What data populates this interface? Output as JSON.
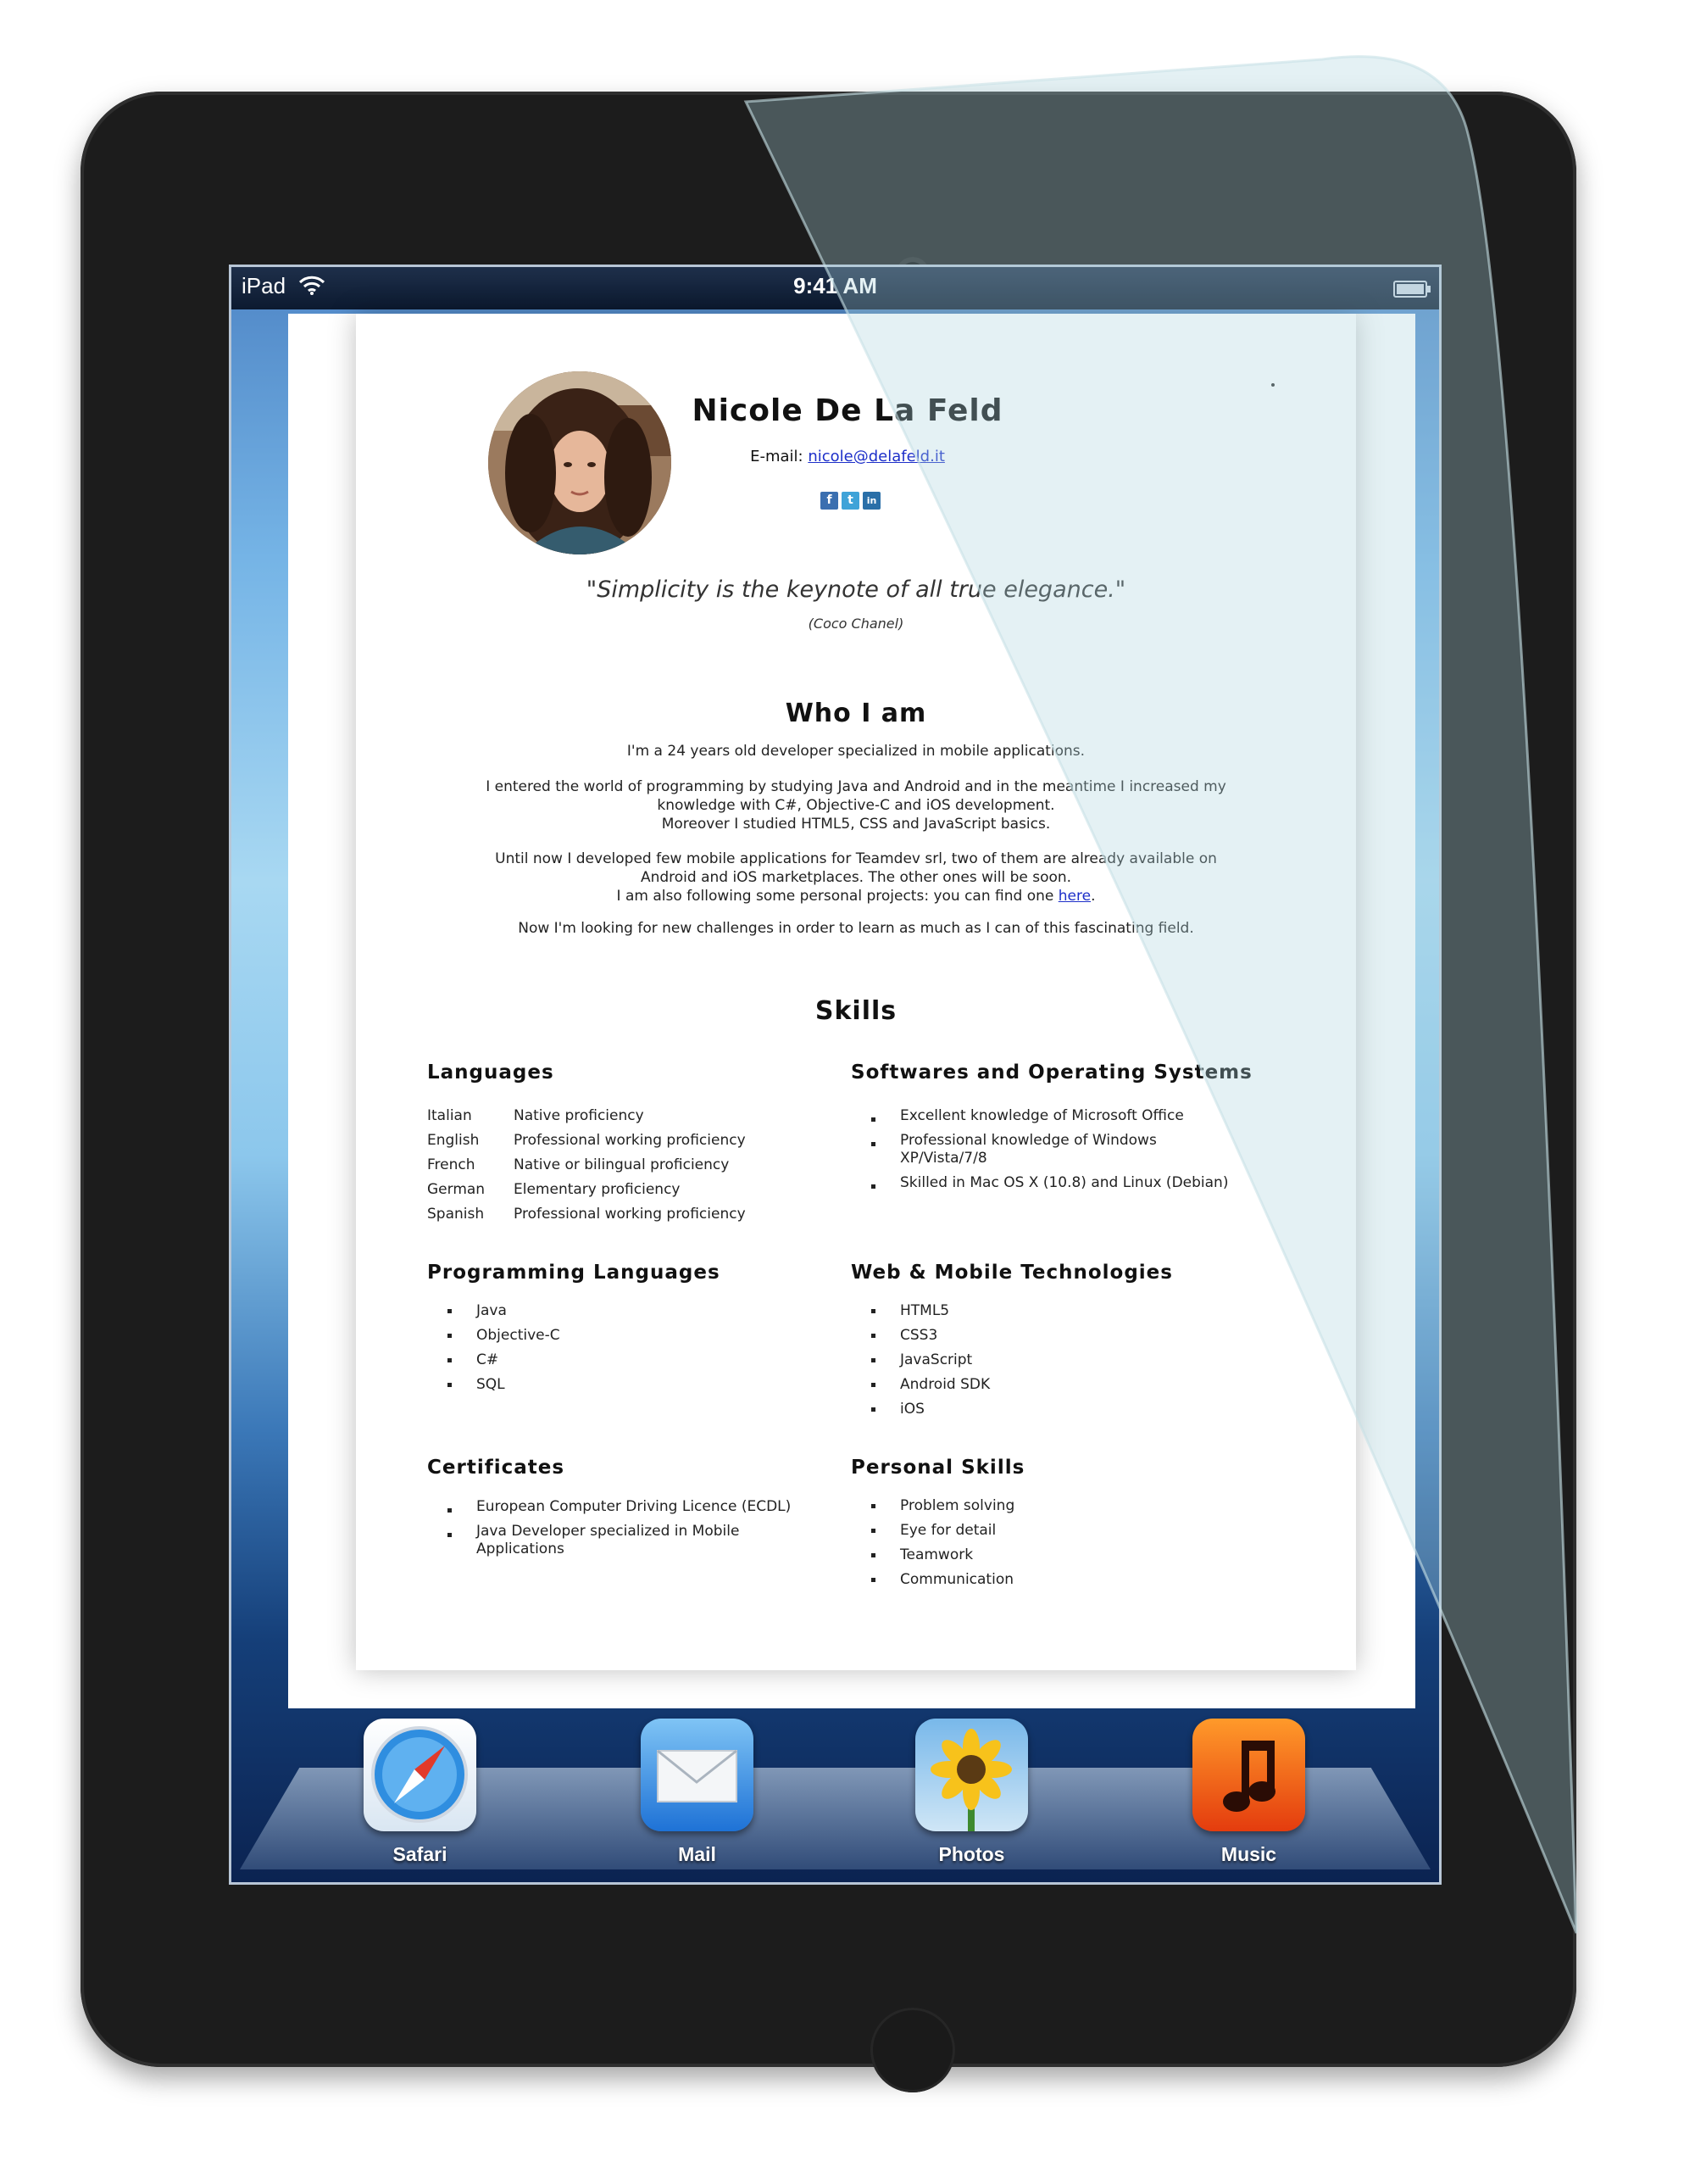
{
  "status_bar": {
    "carrier": "iPad",
    "time": "9:41 AM"
  },
  "profile": {
    "name": "Nicole De La Feld",
    "email_label": "E-mail:",
    "email": "nicole@delafeld.it",
    "social": [
      "f",
      "t",
      "in"
    ]
  },
  "quote": {
    "text": "\"Simplicity is the keynote of all true elegance.\"",
    "author": "(Coco Chanel)"
  },
  "who_i_am": {
    "title": "Who I am",
    "p1": "I'm a 24 years old developer specialized in mobile applications.",
    "p2a": "I entered the world of programming by studying Java and Android and in the meantime I increased my",
    "p2b": "knowledge with C#, Objective-C and iOS development.",
    "p2c": "Moreover I studied HTML5, CSS and JavaScript basics.",
    "p3a": "Until now I developed few mobile applications for Teamdev srl, two of them are already available on",
    "p3b": "Android and iOS marketplaces. The other ones will be soon.",
    "p3c": "I am also following some personal projects: you can find one",
    "p3_link": "here",
    "p4": "Now I'm looking for new challenges in order to learn as much as I can of this fascinating field."
  },
  "skills": {
    "title": "Skills",
    "languages": {
      "title": "Languages",
      "rows": [
        {
          "lang": "Italian",
          "level": "Native proficiency"
        },
        {
          "lang": "English",
          "level": "Professional working proficiency"
        },
        {
          "lang": "French",
          "level": "Native or bilingual proficiency"
        },
        {
          "lang": "German",
          "level": "Elementary proficiency"
        },
        {
          "lang": "Spanish",
          "level": "Professional working proficiency"
        }
      ]
    },
    "software": {
      "title": "Softwares and Operating Systems",
      "items": [
        "Excellent knowledge of Microsoft Office",
        "Professional knowledge of Windows XP/Vista/7/8",
        "Skilled in Mac OS X (10.8) and Linux (Debian)"
      ]
    },
    "programming": {
      "title": "Programming Languages",
      "items": [
        "Java",
        "Objective-C",
        "C#",
        "SQL"
      ]
    },
    "web_mobile": {
      "title": "Web & Mobile Technologies",
      "items": [
        "HTML5",
        "CSS3",
        "JavaScript",
        "Android SDK",
        "iOS"
      ]
    },
    "certificates": {
      "title": "Certificates",
      "items": [
        "European Computer Driving Licence (ECDL)",
        "Java Developer specialized in Mobile Applications"
      ]
    },
    "personal": {
      "title": "Personal Skills",
      "items": [
        "Problem solving",
        "Eye for detail",
        "Teamwork",
        "Communication"
      ]
    }
  },
  "dock": {
    "apps": [
      {
        "label": "Safari",
        "icon": "safari-compass-icon"
      },
      {
        "label": "Mail",
        "icon": "mail-envelope-icon"
      },
      {
        "label": "Photos",
        "icon": "photos-sunflower-icon"
      },
      {
        "label": "Music",
        "icon": "music-note-icon"
      }
    ]
  },
  "colors": {
    "link": "#1d2fc9",
    "device": "#1c1c1c",
    "statusbar": "#0c1a30"
  }
}
